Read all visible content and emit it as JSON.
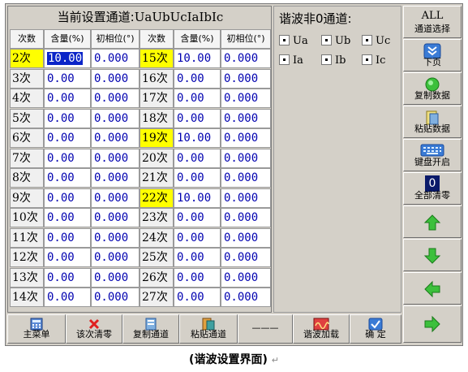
{
  "table": {
    "title_label": "当前设置通道:",
    "title_value": "UaUbUcIaIbIc",
    "headers": [
      "次数",
      "含量(%)",
      "初相位(°)",
      "次数",
      "含量(%)",
      "初相位(°)"
    ],
    "left_rows": [
      {
        "idx": "2次",
        "content": "10.00",
        "phase": "0.000",
        "highlight": true,
        "selected": true
      },
      {
        "idx": "3次",
        "content": "0.00",
        "phase": "0.000",
        "highlight": false
      },
      {
        "idx": "4次",
        "content": "0.00",
        "phase": "0.000",
        "highlight": false
      },
      {
        "idx": "5次",
        "content": "0.00",
        "phase": "0.000",
        "highlight": false
      },
      {
        "idx": "6次",
        "content": "0.00",
        "phase": "0.000",
        "highlight": false
      },
      {
        "idx": "7次",
        "content": "0.00",
        "phase": "0.000",
        "highlight": false
      },
      {
        "idx": "8次",
        "content": "0.00",
        "phase": "0.000",
        "highlight": false
      },
      {
        "idx": "9次",
        "content": "0.00",
        "phase": "0.000",
        "highlight": false
      },
      {
        "idx": "10次",
        "content": "0.00",
        "phase": "0.000",
        "highlight": false
      },
      {
        "idx": "11次",
        "content": "0.00",
        "phase": "0.000",
        "highlight": false
      },
      {
        "idx": "12次",
        "content": "0.00",
        "phase": "0.000",
        "highlight": false
      },
      {
        "idx": "13次",
        "content": "0.00",
        "phase": "0.000",
        "highlight": false
      },
      {
        "idx": "14次",
        "content": "0.00",
        "phase": "0.000",
        "highlight": false
      }
    ],
    "right_rows": [
      {
        "idx": "15次",
        "content": "10.00",
        "phase": "0.000",
        "highlight": true
      },
      {
        "idx": "16次",
        "content": "0.00",
        "phase": "0.000",
        "highlight": false
      },
      {
        "idx": "17次",
        "content": "0.00",
        "phase": "0.000",
        "highlight": false
      },
      {
        "idx": "18次",
        "content": "0.00",
        "phase": "0.000",
        "highlight": false
      },
      {
        "idx": "19次",
        "content": "10.00",
        "phase": "0.000",
        "highlight": true
      },
      {
        "idx": "20次",
        "content": "0.00",
        "phase": "0.000",
        "highlight": false
      },
      {
        "idx": "21次",
        "content": "0.00",
        "phase": "0.000",
        "highlight": false
      },
      {
        "idx": "22次",
        "content": "10.00",
        "phase": "0.000",
        "highlight": true
      },
      {
        "idx": "23次",
        "content": "0.00",
        "phase": "0.000",
        "highlight": false
      },
      {
        "idx": "24次",
        "content": "0.00",
        "phase": "0.000",
        "highlight": false
      },
      {
        "idx": "25次",
        "content": "0.00",
        "phase": "0.000",
        "highlight": false
      },
      {
        "idx": "26次",
        "content": "0.00",
        "phase": "0.000",
        "highlight": false
      },
      {
        "idx": "27次",
        "content": "0.00",
        "phase": "0.000",
        "highlight": false
      }
    ]
  },
  "harmonic_panel": {
    "title": "谐波非0通道:",
    "channels": [
      "Ua",
      "Ub",
      "Uc",
      "Ia",
      "Ib",
      "Ic"
    ]
  },
  "sidebar": {
    "all_label": "ALL",
    "channel_select_label": "通道选择",
    "next_page_label": "下页",
    "copy_data_label": "复制数据",
    "paste_data_label": "粘贴数据",
    "keyboard_label": "键盘开启",
    "clear_all_count": "0",
    "clear_all_label": "全部清零",
    "icons": [
      "chevron-double-down-icon",
      "green-circle-icon",
      "clipboard-icon",
      "keyboard-icon",
      "arrow-up-icon",
      "arrow-down-icon",
      "arrow-left-icon",
      "arrow-right-icon"
    ]
  },
  "toolbar": {
    "main_menu": "主菜单",
    "clear_this": "该次清零",
    "copy_channel": "复制通道",
    "paste_channel": "粘贴通道",
    "blank": "———",
    "harmonic_load": "谐波加载",
    "confirm": "确  定"
  },
  "caption": {
    "text": "(谐波设置界面)",
    "mark": "↵"
  },
  "colors": {
    "highlight": "#ffff00",
    "value_text": "#0000b0",
    "selected_bg": "#0a24c8",
    "panel_bg": "#d4d0c8",
    "arrow_green": "#3cc03c"
  }
}
